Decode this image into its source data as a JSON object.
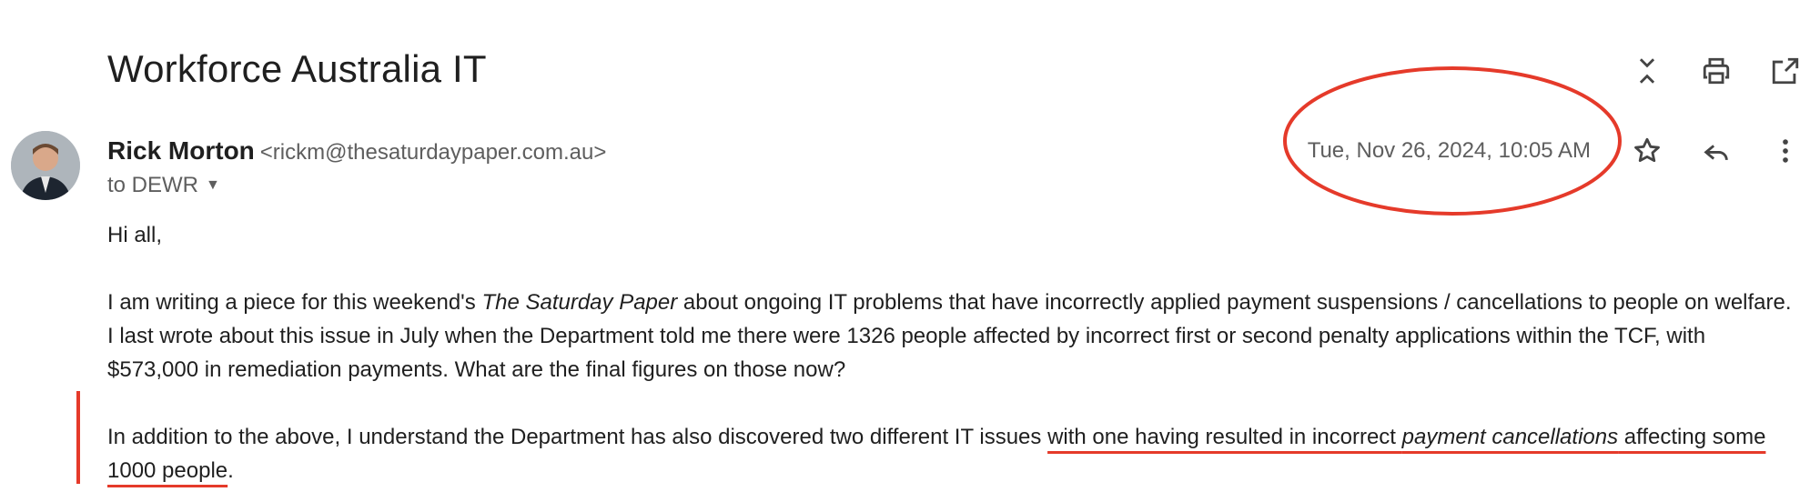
{
  "subject": "Workforce Australia IT",
  "sender": {
    "name": "Rick Morton",
    "email": "<rickm@thesaturdaypaper.com.au>",
    "recipient_line": "to DEWR"
  },
  "date": "Tue, Nov 26, 2024, 10:05 AM",
  "icons": {
    "collapse": "collapse-all-icon",
    "print": "print-icon",
    "open_new": "open-in-new-window-icon",
    "star": "star-icon",
    "reply": "reply-icon",
    "more": "more-vert-icon"
  },
  "body": {
    "greeting": "Hi all,",
    "para1_a": "I am writing a piece for this weekend's ",
    "para1_italic": "The Saturday Paper",
    "para1_b": " about ongoing IT problems that have incorrectly applied payment suspensions / cancellations to people on welfare. I last wrote about this issue in July when the Department told me there were 1326 people affected by incorrect first or second penalty applications within the TCF, with $573,000 in remediation payments. What are the final figures on those now?",
    "para2_a": "In addition to the above, I understand the Department has also discovered two different IT issues ",
    "para2_ul_a": "with one having resulted in incorrect ",
    "para2_ul_italic": "payment cancellations",
    "para2_ul_b": " affecting some 1000 people",
    "para2_end": "."
  },
  "annotation_color": "#e53a2a"
}
